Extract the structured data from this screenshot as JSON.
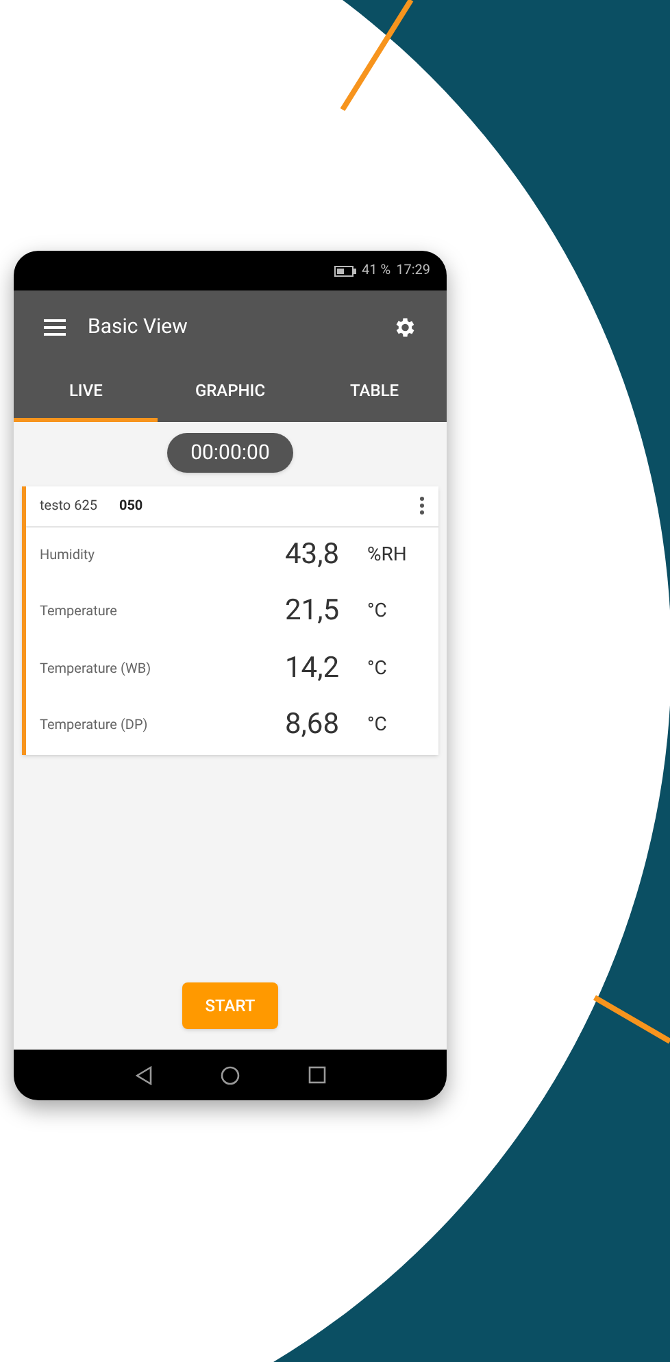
{
  "status_bar": {
    "battery": "41 %",
    "time": "17:29"
  },
  "app_bar": {
    "title": "Basic View"
  },
  "tabs": [
    {
      "label": "LIVE",
      "selected": true
    },
    {
      "label": "GRAPHIC",
      "selected": false
    },
    {
      "label": "TABLE",
      "selected": false
    }
  ],
  "timer": "00:00:00",
  "device": {
    "name": "testo 625",
    "number": "050"
  },
  "readings": [
    {
      "label": "Humidity",
      "value": "43,8",
      "unit": "%RH"
    },
    {
      "label": "Temperature",
      "value": "21,5",
      "unit": "°C"
    },
    {
      "label": "Temperature (WB)",
      "value": "14,2",
      "unit": "°C"
    },
    {
      "label": "Temperature (DP)",
      "value": "8,68",
      "unit": "°C"
    }
  ],
  "start_button": "START"
}
